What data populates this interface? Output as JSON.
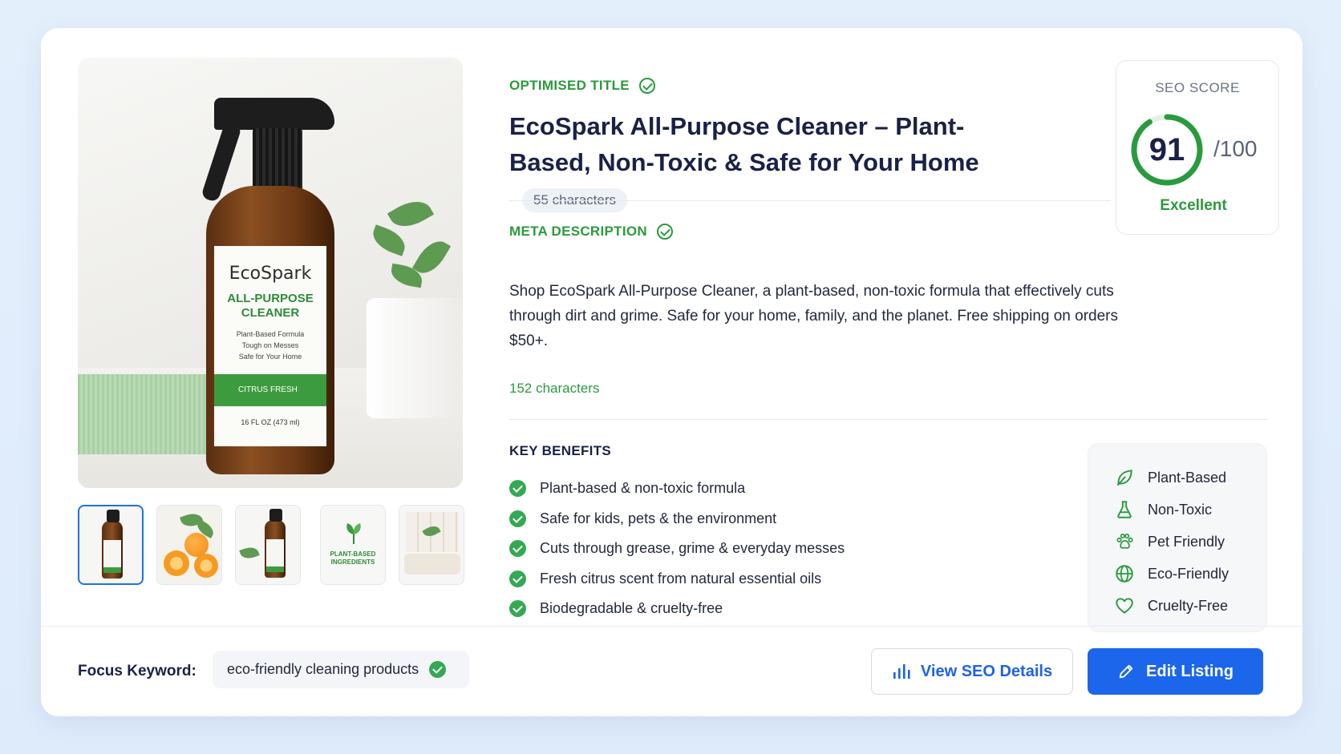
{
  "product_image": {
    "brand": "EcoSpark",
    "product_line_1": "ALL-PURPOSE",
    "product_line_2": "CLEANER",
    "claims": [
      "Plant-Based Formula",
      "Tough on Messes",
      "Safe for Your Home"
    ],
    "scent": "CITRUS FRESH",
    "volume": "16 FL OZ (473 ml)"
  },
  "thumbnails": {
    "ingredients_line_1": "PLANT-BASED",
    "ingredients_line_2": "INGREDIENTS"
  },
  "optimised_title": {
    "label": "OPTIMISED TITLE",
    "text": "EcoSpark All-Purpose Cleaner – Plant-Based, Non-Toxic & Safe for Your Home",
    "char_count": "55 characters"
  },
  "meta_description": {
    "label": "META DESCRIPTION",
    "text": "Shop EcoSpark All-Purpose Cleaner, a plant-based, non-toxic formula that effectively cuts through dirt and grime. Safe for your home, family, and the planet. Free shipping on orders $50+.",
    "char_count": "152 characters"
  },
  "seo_score": {
    "label": "SEO SCORE",
    "value": "91",
    "max": "/100",
    "score_fraction": 0.91,
    "grade": "Excellent",
    "accent": "#2a9a3e"
  },
  "key_benefits": {
    "label": "KEY BENEFITS",
    "items": [
      "Plant-based & non-toxic formula",
      "Safe for kids, pets & the environment",
      "Cuts through grease, grime & everyday messes",
      "Fresh citrus scent from natural essential oils",
      "Biodegradable & cruelty-free"
    ]
  },
  "attribute_tags": [
    {
      "label": "Plant-Based",
      "icon": "leaf-icon"
    },
    {
      "label": "Non-Toxic",
      "icon": "flask-icon"
    },
    {
      "label": "Pet Friendly",
      "icon": "paw-icon"
    },
    {
      "label": "Eco-Friendly",
      "icon": "globe-icon"
    },
    {
      "label": "Cruelty-Free",
      "icon": "heart-icon"
    }
  ],
  "focus_keyword": {
    "label": "Focus Keyword:",
    "value": "eco-friendly cleaning products"
  },
  "actions": {
    "view_seo": "View SEO Details",
    "edit_listing": "Edit Listing"
  },
  "colors": {
    "primary_blue": "#1b66ea",
    "success_green": "#34a853",
    "heading_navy": "#1a2147"
  }
}
